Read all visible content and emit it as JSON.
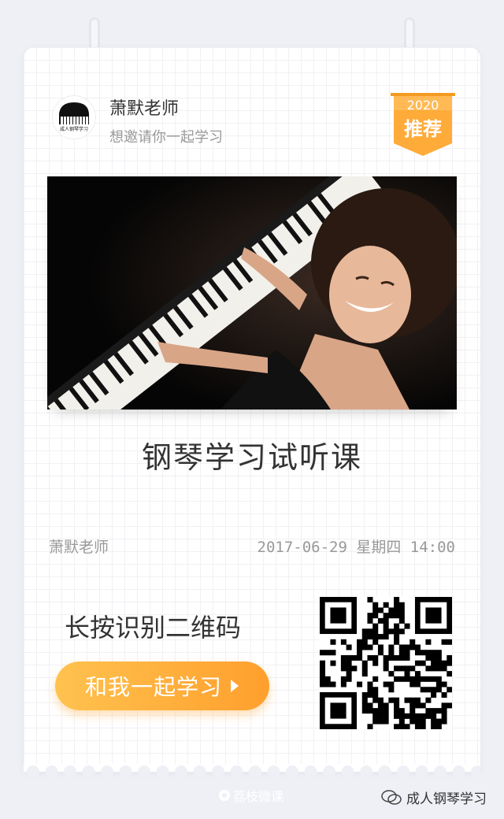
{
  "header": {
    "teacher_name": "萧默老师",
    "invite_text": "想邀请你一起学习",
    "avatar_logo_text": "成人钢琴学习"
  },
  "badge": {
    "year": "2020",
    "label": "推荐",
    "color": "#ffa93a"
  },
  "course": {
    "title": "钢琴学习试听课"
  },
  "meta": {
    "teacher": "萧默老师",
    "datetime": "2017-06-29 星期四 14:00"
  },
  "cta": {
    "qr_hint": "长按识别二维码",
    "button_label": "和我一起学习",
    "accent_color": "#ffa93a"
  },
  "footer": {
    "brand": "荔枝微课",
    "account": "成人钢琴学习"
  }
}
